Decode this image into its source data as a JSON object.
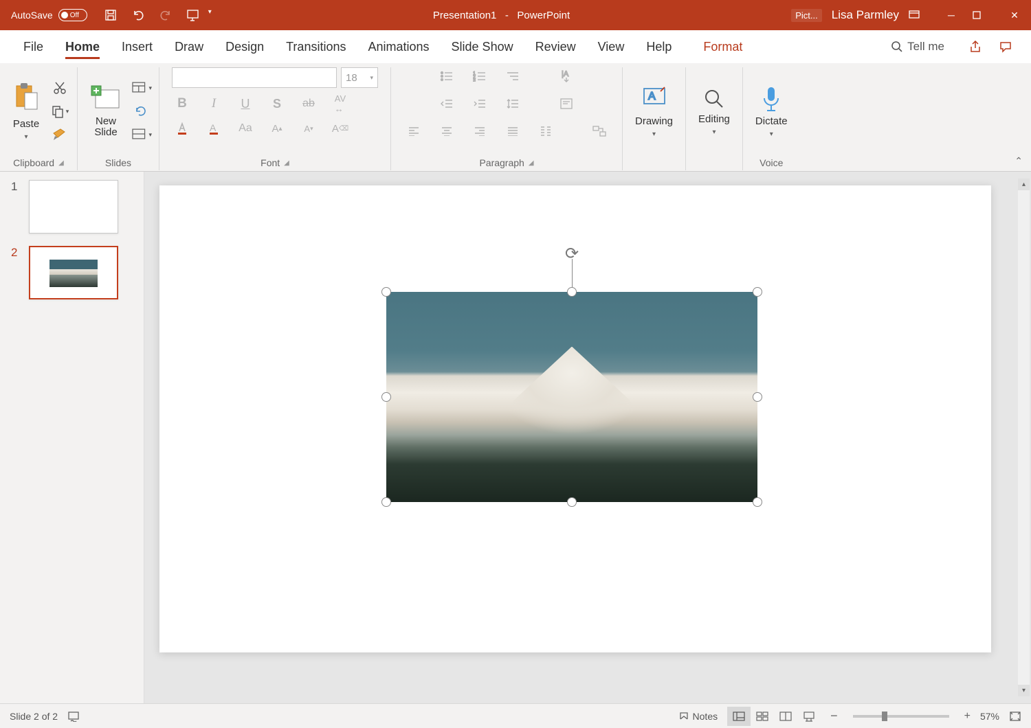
{
  "titlebar": {
    "autosave_label": "AutoSave",
    "autosave_state": "Off",
    "doc_title": "Presentation1",
    "app_name": "PowerPoint",
    "context_tab": "Pict...",
    "user": "Lisa Parmley"
  },
  "menu": {
    "file": "File",
    "tabs": [
      "Home",
      "Insert",
      "Draw",
      "Design",
      "Transitions",
      "Animations",
      "Slide Show",
      "Review",
      "View",
      "Help"
    ],
    "active": "Home",
    "context": "Format",
    "tellme": "Tell me"
  },
  "ribbon": {
    "clipboard": {
      "paste": "Paste",
      "label": "Clipboard"
    },
    "slides": {
      "new_slide": "New\nSlide",
      "label": "Slides"
    },
    "font": {
      "size": "18",
      "label": "Font"
    },
    "paragraph": {
      "label": "Paragraph"
    },
    "drawing": {
      "btn": "Drawing",
      "label": ""
    },
    "editing": {
      "btn": "Editing",
      "label": ""
    },
    "voice": {
      "btn": "Dictate",
      "label": "Voice"
    }
  },
  "thumbs": [
    {
      "n": "1",
      "active": false,
      "has_img": false
    },
    {
      "n": "2",
      "active": true,
      "has_img": true
    }
  ],
  "status": {
    "slide_info": "Slide 2 of 2",
    "notes": "Notes",
    "zoom": "57%"
  }
}
